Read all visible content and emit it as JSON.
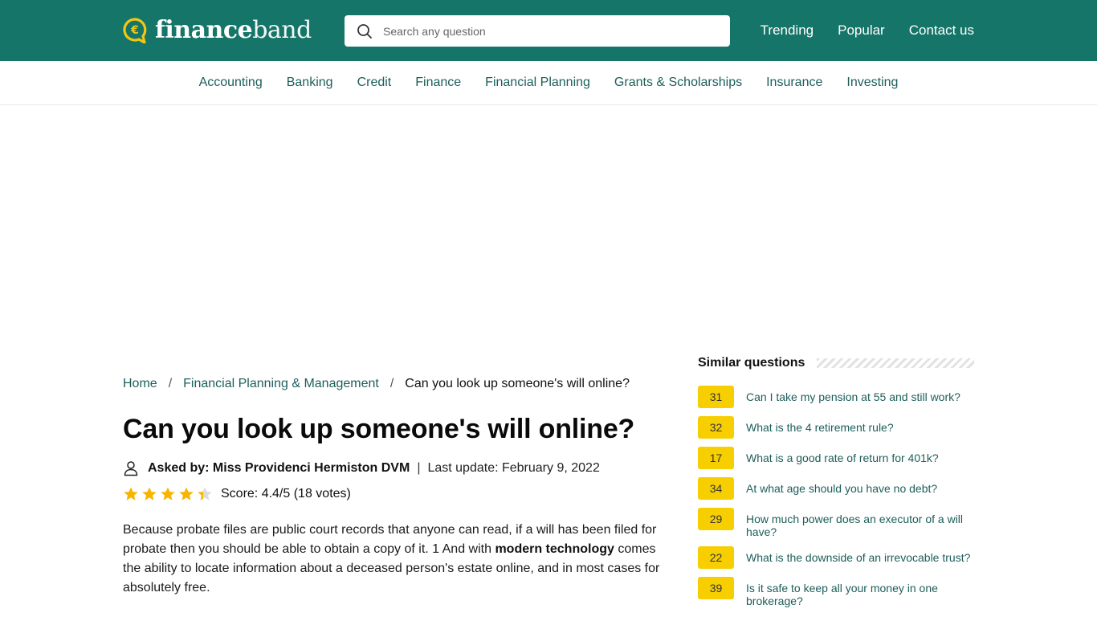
{
  "header": {
    "logo": {
      "part1": "finance",
      "part2": "band",
      "icon": "euro-chat-bubble-icon"
    },
    "search": {
      "placeholder": "Search any question",
      "value": ""
    },
    "nav": [
      {
        "label": "Trending"
      },
      {
        "label": "Popular"
      },
      {
        "label": "Contact us"
      }
    ]
  },
  "categories": [
    {
      "label": "Accounting"
    },
    {
      "label": "Banking"
    },
    {
      "label": "Credit"
    },
    {
      "label": "Finance"
    },
    {
      "label": "Financial Planning"
    },
    {
      "label": "Grants & Scholarships"
    },
    {
      "label": "Insurance"
    },
    {
      "label": "Investing"
    }
  ],
  "breadcrumb": {
    "items": [
      {
        "label": "Home"
      },
      {
        "label": "Financial Planning & Management"
      }
    ],
    "separator": "/",
    "current": "Can you look up someone's will online?"
  },
  "article": {
    "title": "Can you look up someone's will online?",
    "asked_by": "Asked by: Miss Providenci Hermiston DVM",
    "separator": "|",
    "last_update": "Last update: February 9, 2022",
    "rating": {
      "score_text": "Score: 4.4/5 (18 votes)",
      "value": 4.4,
      "max": 5
    },
    "body": {
      "part1": "Because probate files are public court records that anyone can read, if a will has been filed for probate then you should be able to obtain a copy of it. 1 And with ",
      "bold": "modern technology",
      "part2": " comes the ability to locate information about a deceased person's estate online, and in most cases for absolutely free."
    }
  },
  "sidebar": {
    "title": "Similar questions",
    "questions": [
      {
        "count": "31",
        "text": "Can I take my pension at 55 and still work?"
      },
      {
        "count": "32",
        "text": "What is the 4 retirement rule?"
      },
      {
        "count": "17",
        "text": "What is a good rate of return for 401k?"
      },
      {
        "count": "34",
        "text": "At what age should you have no debt?"
      },
      {
        "count": "29",
        "text": "How much power does an executor of a will have?"
      },
      {
        "count": "22",
        "text": "What is the downside of an irrevocable trust?"
      },
      {
        "count": "39",
        "text": "Is it safe to keep all your money in one brokerage?"
      }
    ]
  },
  "colors": {
    "header_bg": "#157569",
    "link": "#1c5e5a",
    "badge": "#f7ce00",
    "star": "#f7b500"
  }
}
